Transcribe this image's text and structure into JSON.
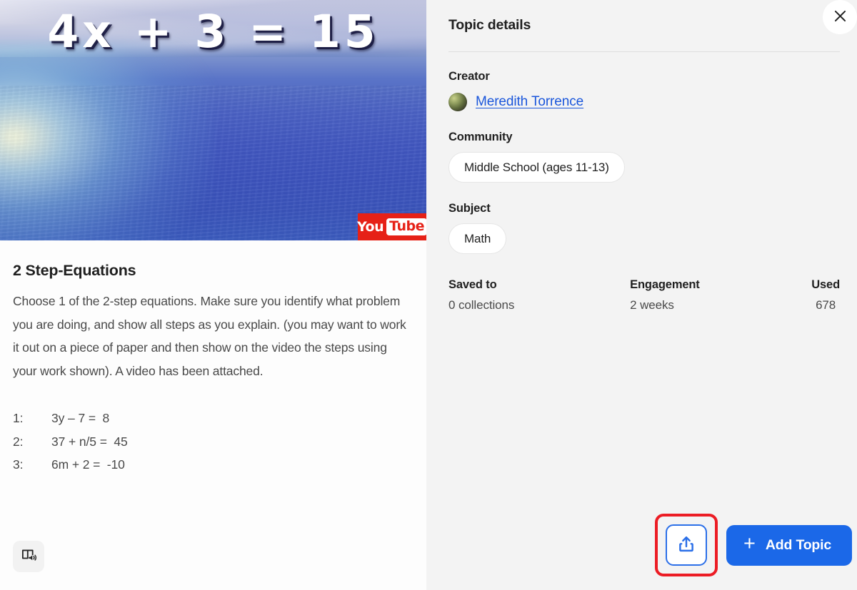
{
  "media": {
    "equation_overlay": "4x + 3 = 15",
    "provider_badge": {
      "you": "You",
      "tube": "Tube",
      "name": "youtube-logo"
    },
    "alt": "video-thumbnail-ocean"
  },
  "topic": {
    "title": "2 Step-Equations",
    "description": "Choose 1 of the 2-step equations.  Make sure you identify what problem you are doing, and show all steps as you explain. (you may want to work it out on a piece of paper and then show on the video the steps using your work shown). A video has been attached.",
    "equations": [
      {
        "num": "1:",
        "expr": "3y – 7 =  8"
      },
      {
        "num": "2:",
        "expr": "37 + n/5 =  45"
      },
      {
        "num": "3:",
        "expr": "6m + 2 =  -10"
      }
    ],
    "reader_button": {
      "icon": "immersive-reader-icon",
      "title": "Immersive Reader"
    }
  },
  "panel": {
    "title": "Topic details",
    "close_icon": "close-icon",
    "creator": {
      "label": "Creator",
      "name": "Meredith Torrence",
      "avatar": "creator-avatar"
    },
    "community": {
      "label": "Community",
      "value": "Middle School (ages 11-13)"
    },
    "subject": {
      "label": "Subject",
      "value": "Math"
    },
    "stats": [
      {
        "label": "Saved to",
        "value": "0 collections"
      },
      {
        "label": "Engagement",
        "value": "2 weeks"
      },
      {
        "label": "Used",
        "value": "678"
      }
    ],
    "actions": {
      "share": {
        "icon": "share-icon",
        "highlighted": true
      },
      "add": {
        "plus": "+",
        "label": "Add Topic"
      }
    }
  },
  "colors": {
    "accent_blue": "#1b68e8",
    "link_blue": "#1a56db",
    "highlight_red": "#ec1c24",
    "panel_bg": "#f3f3f3",
    "youtube_red": "#e62117"
  }
}
